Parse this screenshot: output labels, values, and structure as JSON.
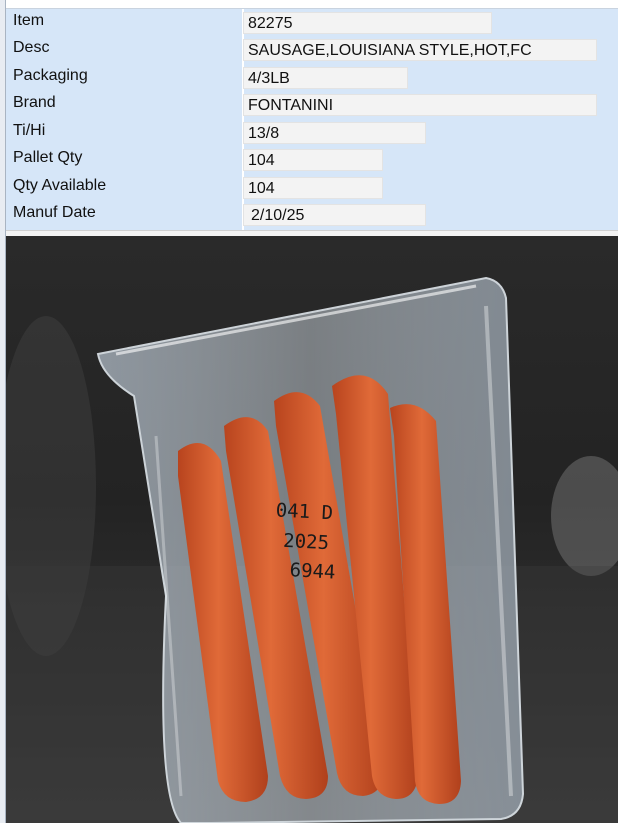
{
  "fields": {
    "item": {
      "label": "Item",
      "value": "82275"
    },
    "desc": {
      "label": "Desc",
      "value": "SAUSAGE,LOUISIANA STYLE,HOT,FC"
    },
    "packaging": {
      "label": "Packaging",
      "value": "4/3LB"
    },
    "brand": {
      "label": "Brand",
      "value": "FONTANINI"
    },
    "tihi": {
      "label": "Ti/Hi",
      "value": "13/8"
    },
    "pallet_qty": {
      "label": "Pallet Qty",
      "value": "104"
    },
    "qty_available": {
      "label": "Qty Available",
      "value": "104"
    },
    "manuf_date": {
      "label": "Manuf Date",
      "value": "2/10/25"
    }
  },
  "photo": {
    "subject": "sausage-vacuum-pack",
    "stamp_lines": [
      "041 D",
      "2025",
      "6944"
    ],
    "colors": {
      "background": "#1e1e1e",
      "sausage": "#d2582c",
      "plastic": "#b9c4cf"
    }
  }
}
